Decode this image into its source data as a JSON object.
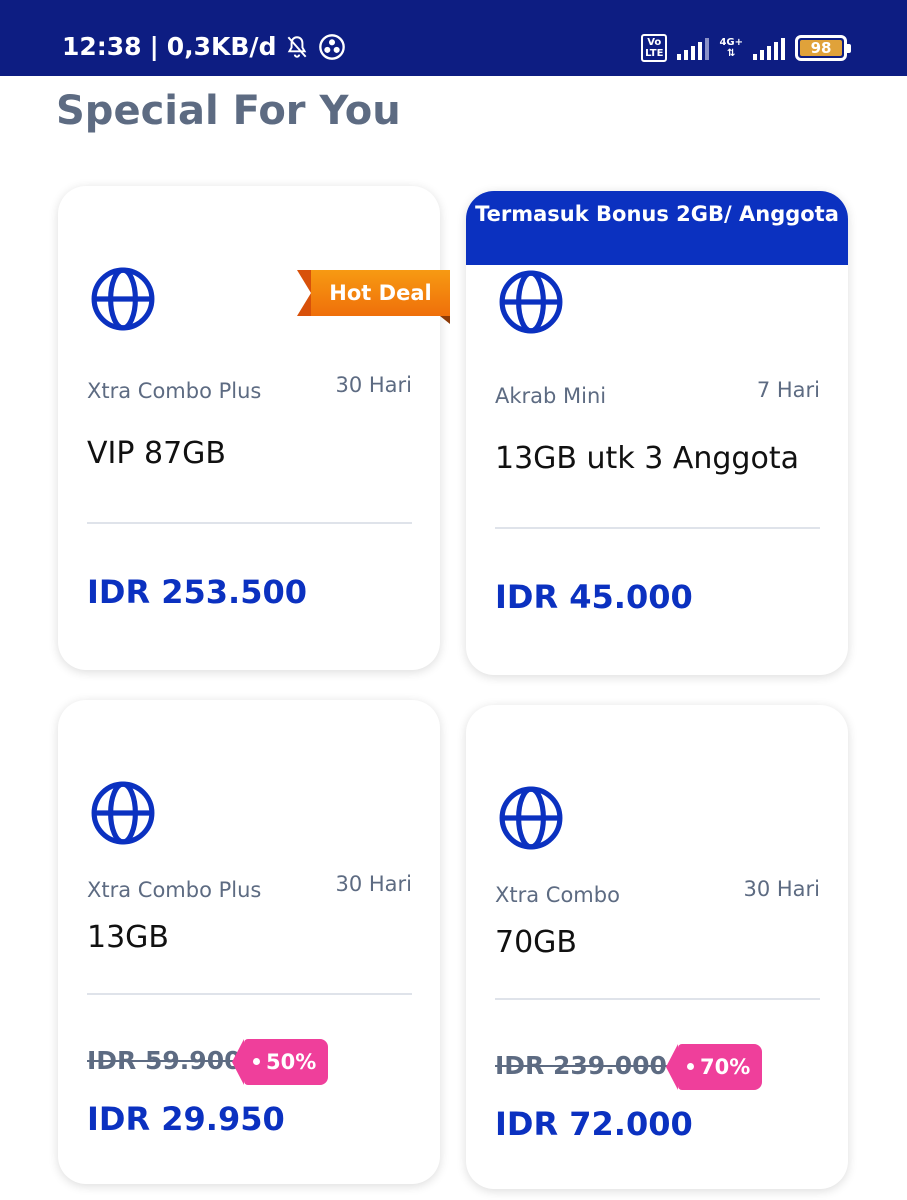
{
  "status_bar": {
    "time": "12:38",
    "separator": "|",
    "speed": "0,3KB/d",
    "volte_top": "Vo",
    "volte_bottom": "LTE",
    "network": "4G+",
    "battery": "98",
    "icons": [
      "bell-off-icon",
      "data-saver-icon",
      "volte-icon",
      "signal-icon",
      "battery-icon"
    ]
  },
  "section": {
    "title": "Special For You"
  },
  "colors": {
    "primary": "#0b31c0",
    "status_bar": "#0d1d82",
    "discount": "#ef3f9b",
    "hot_deal": "#f28a0e",
    "muted": "#5d6b82"
  },
  "cards": [
    {
      "ribbon": "Hot Deal",
      "icon": "globe-icon",
      "name": "Xtra Combo Plus",
      "duration": "30 Hari",
      "quota": "VIP 87GB",
      "price": "IDR 253.500"
    },
    {
      "banner": "Termasuk Bonus 2GB/ Anggota",
      "icon": "globe-icon",
      "name": "Akrab Mini",
      "duration": "7 Hari",
      "quota": "13GB utk 3 Anggota",
      "price": "IDR 45.000"
    },
    {
      "icon": "globe-icon",
      "name": "Xtra Combo Plus",
      "duration": "30 Hari",
      "quota": "13GB",
      "old_price": "IDR 59.900",
      "discount": "50%",
      "price": "IDR 29.950"
    },
    {
      "icon": "globe-icon",
      "name": "Xtra Combo",
      "duration": "30 Hari",
      "quota": "70GB",
      "old_price": "IDR 239.000",
      "discount": "70%",
      "price": "IDR 72.000"
    }
  ]
}
